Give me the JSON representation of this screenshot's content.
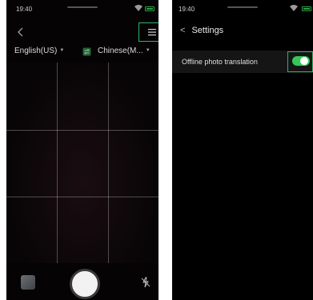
{
  "left_screen": {
    "status_time": "19:40",
    "language": {
      "source": "English(US)",
      "target": "Chinese(M..."
    },
    "icons": {
      "back": "back-chevron-icon",
      "menu": "menu-icon",
      "swap": "swap-languages-icon",
      "gallery": "gallery-thumbnail",
      "shutter": "shutter-button",
      "flash": "flash-off-icon"
    }
  },
  "right_screen": {
    "status_time": "19:40",
    "title": "Settings",
    "settings": [
      {
        "label": "Offline photo translation",
        "enabled": true
      }
    ]
  },
  "colors": {
    "highlight": "#2fb36b",
    "toggle_on": "#34c759",
    "battery": "#2ea043",
    "background": "#000000"
  }
}
